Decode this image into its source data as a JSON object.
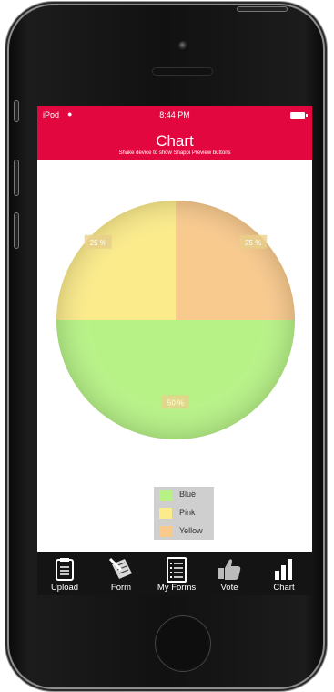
{
  "status_bar": {
    "carrier": "iPod",
    "time": "8:44 PM"
  },
  "header": {
    "title": "Chart",
    "subtitle": "Shake device to show Snappi Preview buttons",
    "color": "#e2083f"
  },
  "chart_data": {
    "type": "pie",
    "slices": [
      {
        "name": "Blue",
        "value": 50,
        "color": "#b7f287",
        "label": "50 %"
      },
      {
        "name": "Pink",
        "value": 25,
        "color": "#fbeb8b",
        "label": "25 %"
      },
      {
        "name": "Yellow",
        "value": 25,
        "color": "#f9ca8e",
        "label": "25 %"
      }
    ],
    "legend": [
      "Blue",
      "Pink",
      "Yellow"
    ],
    "legend_placement": "bottom"
  },
  "tabs": [
    {
      "label": "Upload",
      "icon": "clipboard-icon"
    },
    {
      "label": "Form",
      "icon": "pencil-paper-icon"
    },
    {
      "label": "My Forms",
      "icon": "list-document-icon"
    },
    {
      "label": "Vote",
      "icon": "thumbs-up-icon"
    },
    {
      "label": "Chart",
      "icon": "bar-chart-icon"
    }
  ]
}
